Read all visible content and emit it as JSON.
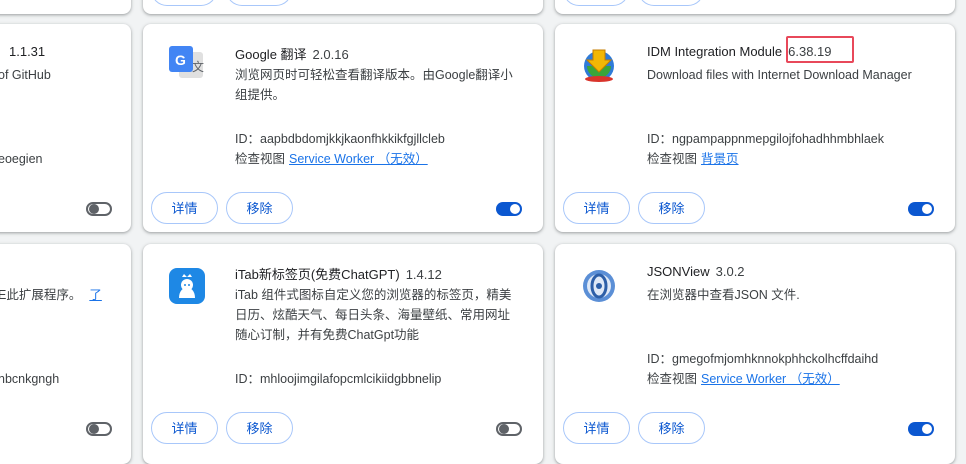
{
  "cards": {
    "left_mid": {
      "version": "1.1.31",
      "desc": "of GitHub",
      "id_tail": "eoegien"
    },
    "left_bottom": {
      "desc_tail": "E此扩展程序。",
      "link_tail": "了",
      "id_tail": "nbcnkgngh"
    },
    "google_translate": {
      "name": "Google 翻译",
      "version": "2.0.16",
      "desc": "浏览网页时可轻松查看翻译版本。由Google翻译小组提供。",
      "id_label": "ID：",
      "id": "aapbdbdomjkkjkaonfhkkikfgjllcleb",
      "inspect_label": "检查视图",
      "inspect_link": "Service Worker （无效）",
      "details": "详情",
      "remove": "移除",
      "enabled": true
    },
    "idm": {
      "name": "IDM Integration Module",
      "version": "6.38.19",
      "desc": "Download files with Internet Download Manager",
      "id_label": "ID：",
      "id": "ngpampappnmepgilojfohadhhmbhlaek",
      "inspect_label": "检查视图",
      "inspect_link": "背景页",
      "details": "详情",
      "remove": "移除",
      "enabled": true
    },
    "itab": {
      "name": "iTab新标签页(免费ChatGPT)",
      "version": "1.4.12",
      "desc_line1": "iTab 组件式图标自定义您的浏览器的标签页，精美",
      "desc_line2": "日历、炫酷天气、每日头条、海量壁纸、常用网址",
      "desc_line3": "随心订制，并有免费ChatGpt功能",
      "id_label": "ID：",
      "id": "mhloojimgilafopcmlcikiidgbbnelip",
      "details": "详情",
      "remove": "移除",
      "enabled": false
    },
    "jsonview": {
      "name": "JSONView",
      "version": "3.0.2",
      "desc": "在浏览器中查看JSON 文件.",
      "id_label": "ID：",
      "id": "gmegofmjomhknnokphhckolhcffdaihd",
      "inspect_label": "检查视图",
      "inspect_link": "Service Worker （无效）",
      "details": "详情",
      "remove": "移除",
      "enabled": true
    }
  },
  "colors": {
    "accent": "#0b57d0",
    "highlight": "#e8485a",
    "link": "#1a73e8"
  }
}
